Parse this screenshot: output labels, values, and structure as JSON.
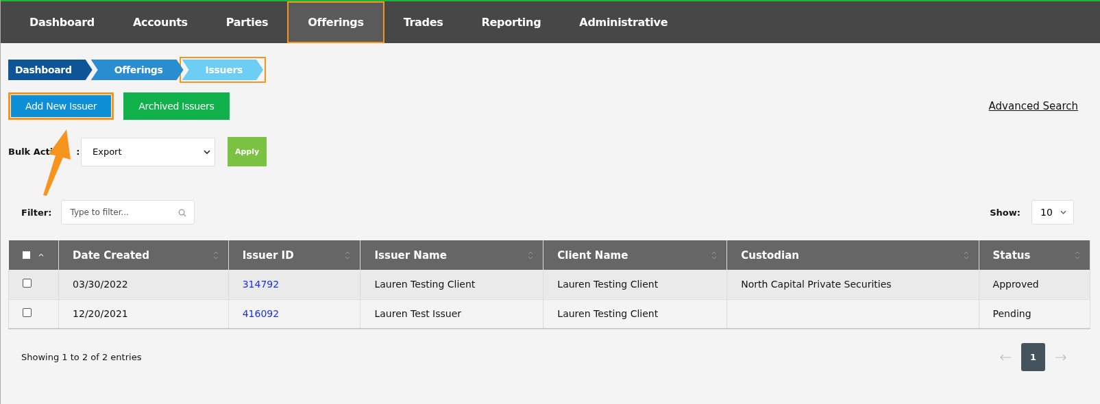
{
  "nav": {
    "tabs": [
      {
        "label": "Dashboard",
        "selected": false,
        "highlighted": false
      },
      {
        "label": "Accounts",
        "selected": false,
        "highlighted": false
      },
      {
        "label": "Parties",
        "selected": false,
        "highlighted": false
      },
      {
        "label": "Offerings",
        "selected": true,
        "highlighted": true
      },
      {
        "label": "Trades",
        "selected": false,
        "highlighted": false
      },
      {
        "label": "Reporting",
        "selected": false,
        "highlighted": false
      },
      {
        "label": "Administrative",
        "selected": false,
        "highlighted": false
      }
    ]
  },
  "breadcrumb": [
    {
      "label": "Dashboard",
      "highlighted": false
    },
    {
      "label": "Offerings",
      "highlighted": false
    },
    {
      "label": "Issuers",
      "highlighted": true
    }
  ],
  "actions": [
    {
      "label": "Add New Issuer",
      "kind": "primary",
      "highlighted": true
    },
    {
      "label": "Archived Issuers",
      "kind": "secondary",
      "highlighted": false
    }
  ],
  "advanced_search": "Advanced Search",
  "bulk_action": {
    "label": "Bulk Acti",
    "label_end": ":",
    "value": "Export",
    "button": "Apply"
  },
  "filter": {
    "label": "Filter:",
    "placeholder": "Type to filter..."
  },
  "show": {
    "label": "Show:",
    "value": "10"
  },
  "table": {
    "select_all_checked": false,
    "columns": [
      "Date Created",
      "Issuer ID",
      "Issuer Name",
      "Client Name",
      "Custodian",
      "Status"
    ],
    "rows": [
      {
        "checked": false,
        "cells": [
          "03/30/2022",
          "314792",
          "Lauren Testing Client",
          "Lauren Testing Client",
          "North Capital Private Securities",
          "Approved"
        ]
      },
      {
        "checked": false,
        "cells": [
          "12/20/2021",
          "416092",
          "Lauren Test Issuer",
          "Lauren Testing Client",
          "",
          "Pending"
        ]
      }
    ]
  },
  "footer": {
    "summary": "Showing 1 to 2 of 2 entries",
    "pages": [
      {
        "label": "1",
        "selected": true
      }
    ]
  },
  "annotation": {
    "arrow": true
  }
}
